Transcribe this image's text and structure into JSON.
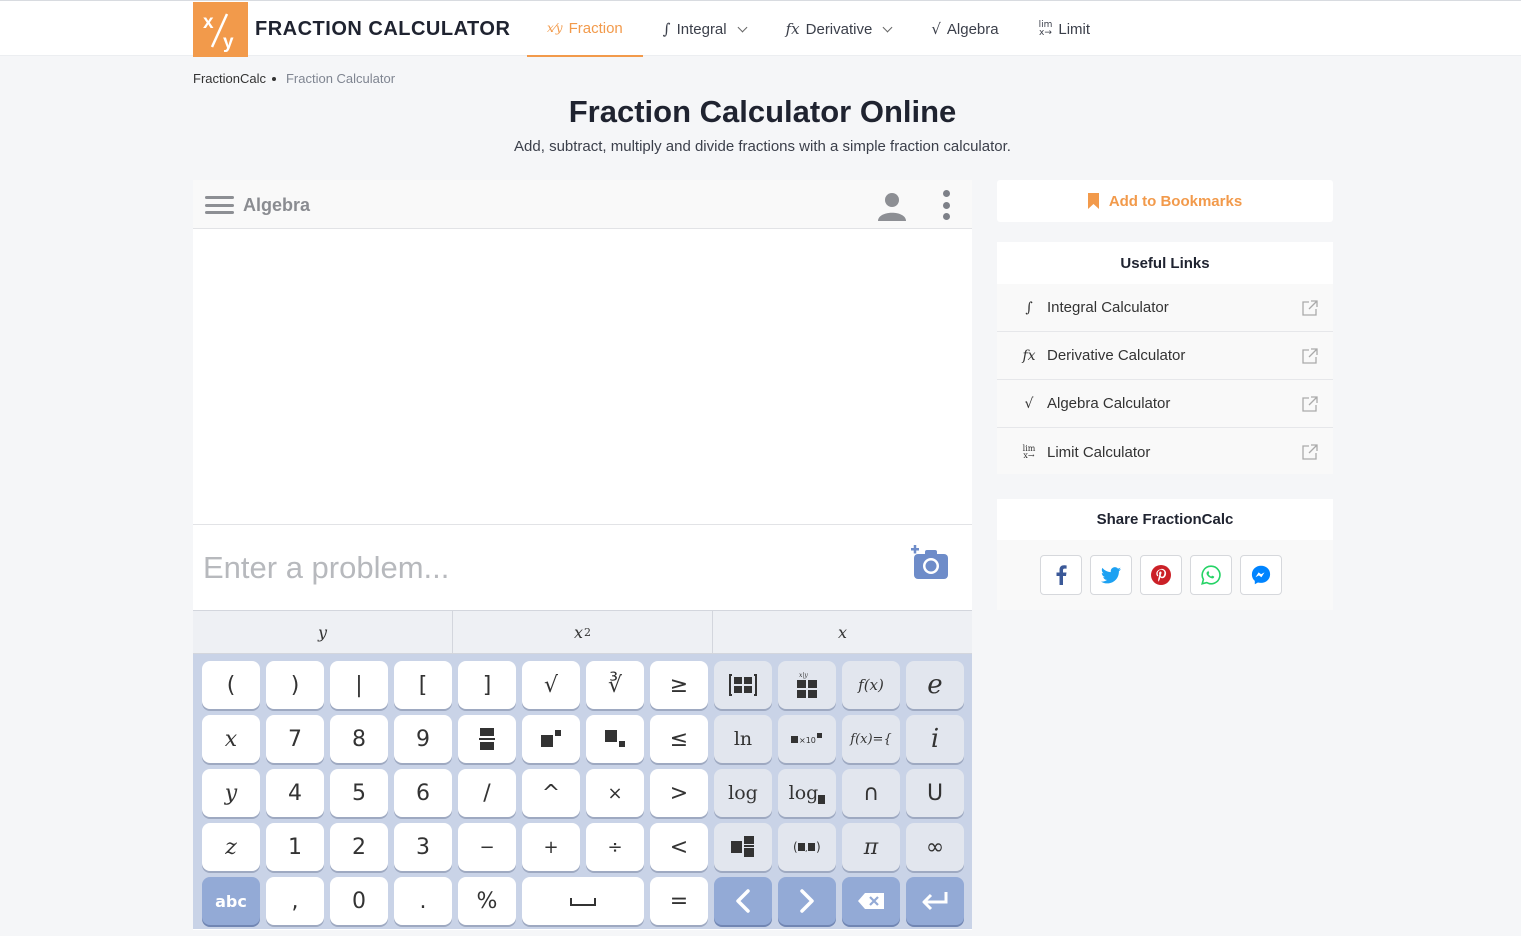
{
  "brand": {
    "logo_text": "FRACTION CALCULATOR"
  },
  "nav": {
    "fraction": {
      "icon": "fraction-icon",
      "label": "Fraction"
    },
    "integral": {
      "icon": "integral-icon",
      "label": "Integral"
    },
    "derivative": {
      "icon": "derivative-icon",
      "label": "Derivative"
    },
    "algebra": {
      "icon": "sqrt-icon",
      "label": "Algebra"
    },
    "limit": {
      "icon": "limit-icon",
      "label": "Limit"
    }
  },
  "breadcrumb": {
    "home": "FractionCalc",
    "current": "Fraction Calculator"
  },
  "page": {
    "title": "Fraction Calculator Online",
    "subtitle": "Add, subtract, multiply and divide fractions with a simple fraction calculator."
  },
  "calculator": {
    "title": "Algebra",
    "input_placeholder": "Enter a problem...",
    "tabs": {
      "y": "y",
      "x2_base": "x",
      "x2_exp": "2",
      "x": "x"
    },
    "keys": {
      "row1": [
        "(",
        ")",
        "|",
        "[",
        "]",
        "√",
        "∛",
        "≥",
        "",
        "",
        "f(x)",
        "e"
      ],
      "row2": [
        "x",
        "7",
        "8",
        "9",
        "",
        "",
        "",
        "≤",
        "ln",
        "",
        "f(x)={",
        "i"
      ],
      "row3": [
        "y",
        "4",
        "5",
        "6",
        "/",
        "^",
        "×",
        ">",
        "log",
        "log",
        "∩",
        "U"
      ],
      "row4": [
        "z",
        "1",
        "2",
        "3",
        "−",
        "+",
        "÷",
        "<",
        "",
        "",
        "π",
        "∞"
      ],
      "row5": [
        "abc",
        ",",
        "0",
        ".",
        "%",
        "",
        "="
      ]
    }
  },
  "sidebar": {
    "bookmark_label": "Add to Bookmarks",
    "useful_links": {
      "title": "Useful Links",
      "items": [
        {
          "icon": "integral-icon",
          "label": "Integral Calculator"
        },
        {
          "icon": "derivative-icon",
          "label": "Derivative Calculator"
        },
        {
          "icon": "sqrt-icon",
          "label": "Algebra Calculator"
        },
        {
          "icon": "limit-icon",
          "label": "Limit Calculator"
        }
      ]
    },
    "share": {
      "title": "Share FractionCalc",
      "networks": [
        "facebook-icon",
        "twitter-icon",
        "pinterest-icon",
        "whatsapp-icon",
        "messenger-icon"
      ]
    }
  },
  "colors": {
    "accent": "#f29a4b",
    "keyboard_bg": "#c9d3e7",
    "key_blue": "#93aad6"
  }
}
